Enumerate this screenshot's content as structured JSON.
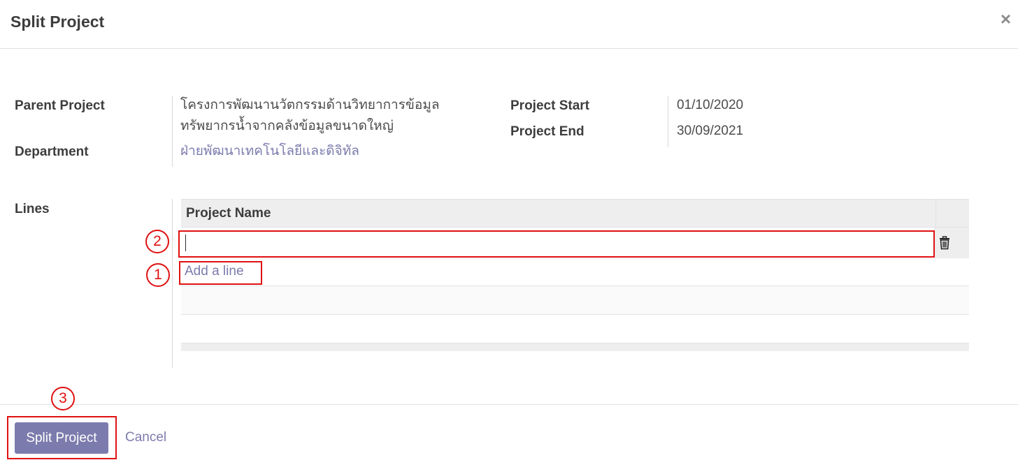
{
  "dialog": {
    "title": "Split Project",
    "close_icon": "×"
  },
  "form": {
    "parent_project_label": "Parent Project",
    "parent_project_value_line1": "โครงการพัฒนานวัตกรรมด้านวิทยาการข้อมูล",
    "parent_project_value_line2": "ทรัพยากรน้ำจากคลังข้อมูลขนาดใหญ่",
    "department_label": "Department",
    "department_value": "ฝ่ายพัฒนาเทคโนโลยีและดิจิทัล",
    "project_start_label": "Project Start",
    "project_start_value": "01/10/2020",
    "project_end_label": "Project End",
    "project_end_value": "30/09/2021",
    "lines_label": "Lines"
  },
  "lines_table": {
    "column_header": "Project Name",
    "rows": [
      {
        "project_name": ""
      }
    ],
    "add_line_label": "Add a line"
  },
  "annotations": {
    "marker_1": "1",
    "marker_2": "2",
    "marker_3": "3",
    "color": "#e01010"
  },
  "footer": {
    "split_button_label": "Split Project",
    "cancel_label": "Cancel"
  },
  "colors": {
    "accent": "#7c7bad",
    "table_header_bg": "#eeeeee"
  }
}
